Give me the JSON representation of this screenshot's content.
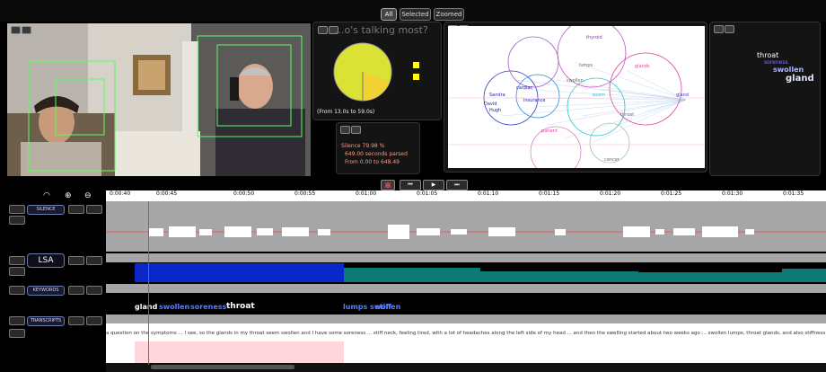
{
  "view_buttons": {
    "all": "All",
    "selected": "Selected",
    "zoomed": "Zoomed"
  },
  "talk_panel": {
    "title": "...o's talking most?",
    "range": "(From 13.0s to 59.0s)"
  },
  "silence_panel": {
    "line1": "Silence 79.98 %",
    "line2": "649.00 seconds parsed",
    "line3": "From 0.00 to 648.49"
  },
  "network_nodes": [
    "Sandra",
    "David",
    "Hugh",
    "cardiac",
    "insurance",
    "thyroid",
    "lumps",
    "glands",
    "exam",
    "swollen",
    "throat",
    "patient",
    "cancer",
    "gland"
  ],
  "wordcloud": [
    {
      "text": "throat",
      "color": "#ffffff"
    },
    {
      "text": "soreness",
      "color": "#7a7aff"
    },
    {
      "text": "swollen",
      "color": "#aab4ff"
    },
    {
      "text": "gland",
      "color": "#dfe4ff"
    }
  ],
  "ruler_ticks": [
    "0:00:40",
    "0:00:45",
    "0:00:50",
    "0:00:55",
    "0:01:00",
    "0:01:05",
    "0:01:10",
    "0:01:15",
    "0:01:20",
    "0:01:25",
    "0:01:30",
    "0:01:35"
  ],
  "tracks": {
    "silence": "SILENCE",
    "lsa": "LSA",
    "keywords": "KEYWORDS",
    "transcripts": "TRANSCRIPTS"
  },
  "keywords_row": [
    {
      "text": "gland",
      "color": "#ffffff"
    },
    {
      "text": "swollen",
      "color": "#5a7dff"
    },
    {
      "text": "soreness",
      "color": "#5a7dff"
    },
    {
      "text": "throat",
      "color": "#ffffff"
    }
  ],
  "keywords_row2": [
    {
      "text": "lumps swollen",
      "color": "#5a7dff"
    },
    {
      "text": "stiff",
      "color": "#5a7dff"
    }
  ],
  "transcript_text": "a question on the symptoms ... I see, so the glands in my throat seem swollen and I have some soreness ... stiff neck, feeling tired, with a lot of headaches along the left side of my head ... and then the swelling started about two weeks ago ... swollen lumps, throat glands, and also stiffness in the morning ... which is a common case of the thyroid glands being enlarged ...",
  "colors": {
    "lsa_blue": "#0a28c8",
    "lsa_teal": "#0d7a78",
    "playhead": "#ff3030",
    "highlight": "#ffd6dc"
  }
}
